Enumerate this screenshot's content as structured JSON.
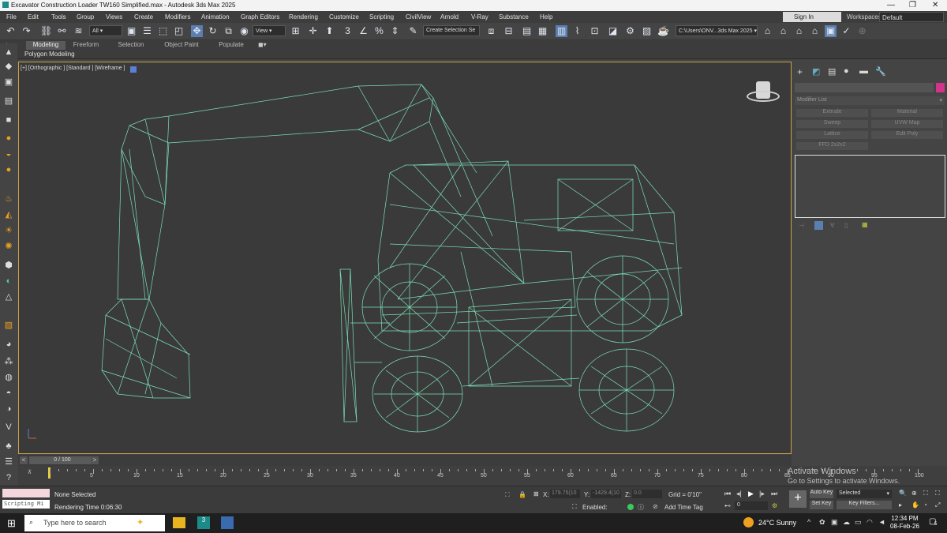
{
  "title": "Excavator Construction Loader TW160 Simplified.max - Autodesk 3ds Max 2025",
  "window_controls": [
    "—",
    "❐",
    "✕"
  ],
  "menu": [
    "File",
    "Edit",
    "Tools",
    "Group",
    "Views",
    "Create",
    "Modifiers",
    "Animation",
    "Graph Editors",
    "Rendering",
    "Customize",
    "Scripting",
    "CivilView",
    "Arnold",
    "V-Ray",
    "Substance",
    "Help"
  ],
  "signin": "Sign In",
  "workspaces_label": "Workspaces:",
  "workspace_value": "Default",
  "toolbar": {
    "filter_value": "All",
    "refcoord_value": "View",
    "selection_set": "Create Selection Se",
    "path": "C:\\Users\\ONV...3ds Max 2025"
  },
  "ribbon": {
    "tabs": [
      "Modeling",
      "Freeform",
      "Selection",
      "Object Paint",
      "Populate"
    ],
    "active": "Modeling",
    "sub": "Polygon Modeling"
  },
  "viewport_label": "[+] [Orthographic ] [Standard ] [Wireframe ]",
  "command_panel": {
    "modifier_list": "Modifier List",
    "buttons": [
      "Extrude",
      "Material",
      "Sweep",
      "UVW Map",
      "Lattice",
      "Edit Poly",
      "FFD 2x2x2"
    ]
  },
  "timeline": {
    "frame": "0 / 100",
    "ticks": [
      "5",
      "10",
      "15",
      "20",
      "25",
      "30",
      "35",
      "40",
      "45",
      "50",
      "55",
      "60",
      "65",
      "70",
      "75",
      "80",
      "85",
      "90",
      "95",
      "100"
    ]
  },
  "status": {
    "listener": "Scripting Mi",
    "selected": "None Selected",
    "render_time": "Rendering Time  0:06:30",
    "x_label": "X:",
    "x_value": "179.75(10",
    "y_label": "Y:",
    "y_value": "-1429.4(10",
    "z_label": "Z:",
    "z_value": "0.0",
    "grid": "Grid = 0'10\"",
    "enabled": "Enabled:",
    "add_time_tag": "Add Time Tag",
    "auto_key": "Auto Key",
    "set_key": "Set Key",
    "selected_dd": "Selected",
    "key_filters": "Key Filters...",
    "frame_field": "0"
  },
  "watermark": {
    "line1": "Activate Windows",
    "line2": "Go to Settings to activate Windows."
  },
  "taskbar": {
    "search_placeholder": "Type here to search",
    "weather": "24°C  Sunny",
    "time": "12:34 PM",
    "date": "08-Feb-26",
    "notif": "5"
  }
}
